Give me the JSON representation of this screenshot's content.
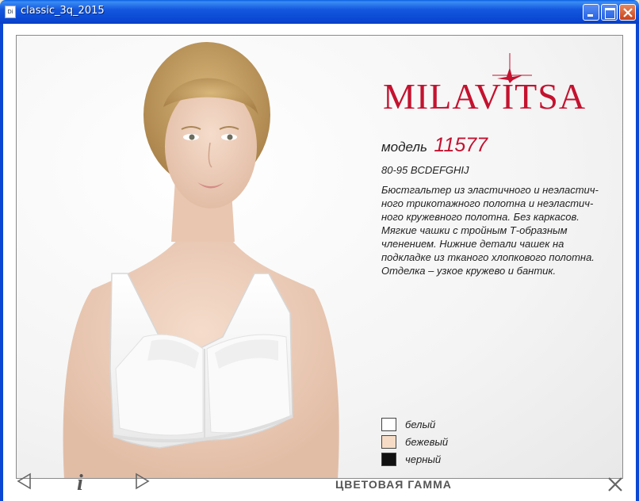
{
  "window": {
    "title": "classic_3q_2015",
    "app_icon": "document-icon"
  },
  "brand": {
    "logo_text": "MILAVITSA",
    "accent_color": "#c4122f"
  },
  "product": {
    "model_label": "модель",
    "model_number": "11577",
    "sizes": "80-95 BCDEFGHIJ",
    "description_lines": [
      "Бюстгальтер из эластичного и неэластич-",
      "ного трикотажного полотна и неэластич-",
      "ного кружевного полотна. Без каркасов.",
      "Мягкие чашки с тройным Т-образным",
      "членением. Нижние детали чашек на",
      "подкладке из тканого хлопкового полотна.",
      "Отделка – узкое кружево и бантик."
    ]
  },
  "colors": [
    {
      "name": "белый",
      "hex": "#ffffff"
    },
    {
      "name": "бежевый",
      "hex": "#f6dcc6"
    },
    {
      "name": "черный",
      "hex": "#111111"
    }
  ],
  "nav": {
    "prev_icon": "triangle-left-icon",
    "info_label": "i",
    "next_icon": "triangle-right-icon",
    "section_title": "ЦВЕТОВАЯ ГАММА",
    "close_icon": "close-icon"
  }
}
